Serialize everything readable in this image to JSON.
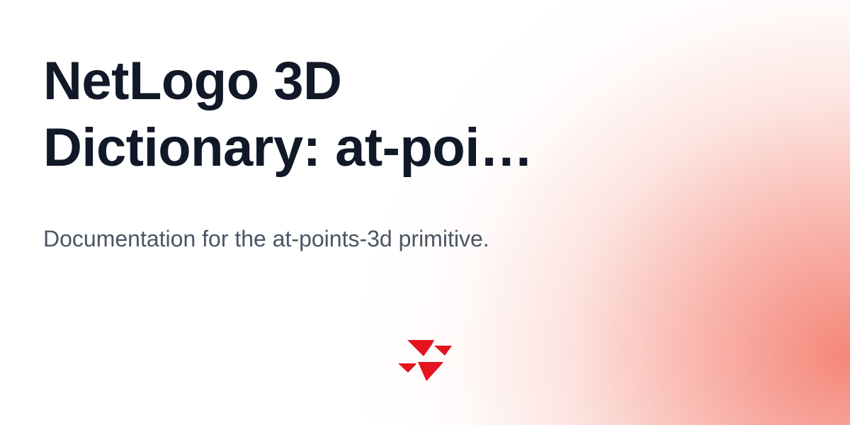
{
  "title_lines": [
    "NetLogo 3D",
    "Dictionary: at-poi…"
  ],
  "subtitle": "Documentation for the at-points-3d primitive.",
  "logo_icon": "netlogo-turtle-logo-icon",
  "colors": {
    "title": "#111827",
    "subtitle": "#4b5563",
    "accent_glow": "#f47c6e",
    "logo_red": "#e3141e",
    "logo_dark_red": "#9e0b10"
  }
}
